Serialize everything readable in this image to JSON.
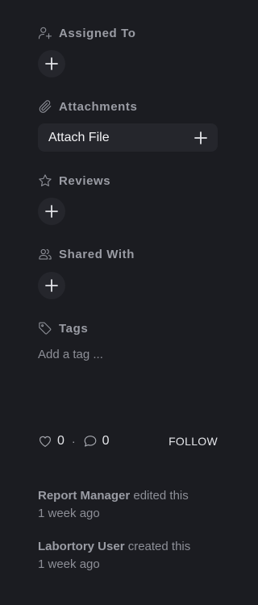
{
  "assigned": {
    "title": "Assigned To",
    "icon": "user-plus-icon"
  },
  "attachments": {
    "title": "Attachments",
    "icon": "paperclip-icon",
    "button_label": "Attach File"
  },
  "reviews": {
    "title": "Reviews",
    "icon": "star-icon"
  },
  "shared": {
    "title": "Shared With",
    "icon": "users-icon"
  },
  "tags": {
    "title": "Tags",
    "icon": "tag-icon",
    "placeholder": "Add a tag ..."
  },
  "stats": {
    "likes": "0",
    "separator": "·",
    "comments": "0",
    "follow_label": "FOLLOW"
  },
  "activity": [
    {
      "user": "Report Manager",
      "action": "edited this",
      "time": "1 week ago"
    },
    {
      "user": "Labortory User",
      "action": "created this",
      "time": "1 week ago"
    }
  ],
  "colors": {
    "background": "#1b1c21",
    "button_bg": "#25262c",
    "heading": "#9a9ca4"
  }
}
